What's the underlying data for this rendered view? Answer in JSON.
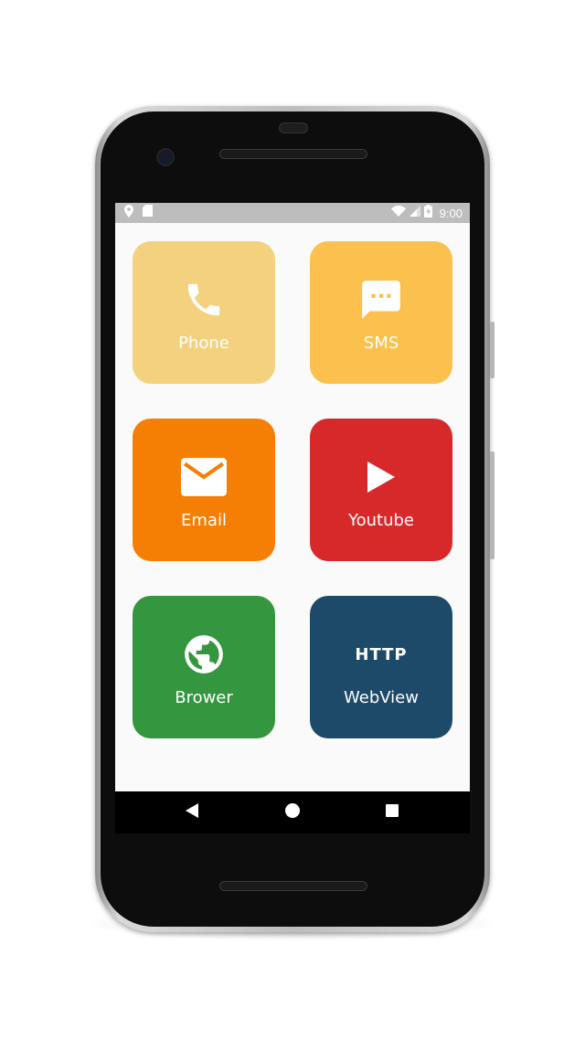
{
  "status_bar": {
    "time": "9:00",
    "icons": [
      "location-icon",
      "sd-card-icon",
      "wifi-icon",
      "signal-icon",
      "battery-icon"
    ]
  },
  "tiles": [
    {
      "label": "Phone",
      "icon": "phone-icon",
      "color": "#F3D17E"
    },
    {
      "label": "SMS",
      "icon": "sms-icon",
      "color": "#FBC04E"
    },
    {
      "label": "Email",
      "icon": "email-icon",
      "color": "#F57F05"
    },
    {
      "label": "Youtube",
      "icon": "play-icon",
      "color": "#D8292A"
    },
    {
      "label": "Brower",
      "icon": "globe-icon",
      "color": "#34963E"
    },
    {
      "label": "WebView",
      "icon": "http-icon",
      "color": "#1C4A68",
      "icon_text": "HTTP"
    }
  ],
  "nav_bar": {
    "buttons": [
      "back-icon",
      "home-icon",
      "recents-icon"
    ]
  }
}
